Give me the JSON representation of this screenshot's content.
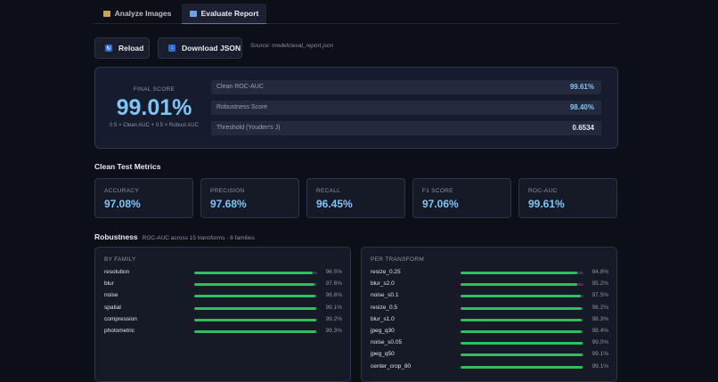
{
  "tabs": [
    {
      "label": "Analyze Images",
      "icon": "image-icon",
      "active": false
    },
    {
      "label": "Evaluate Report",
      "icon": "chart-icon",
      "active": true
    }
  ],
  "toolbar": {
    "reload_label": "Reload",
    "download_label": "Download JSON",
    "source_text": "Source: models\\eval_report.json"
  },
  "score": {
    "label": "FINAL SCORE",
    "value": "99.01%",
    "formula": "0.5 × Clean AUC + 0.5 × Robust AUC",
    "rows": [
      {
        "key": "Clean ROC-AUC",
        "value": "99.61%"
      },
      {
        "key": "Robustness Score",
        "value": "98.40%"
      },
      {
        "key": "Threshold (Youden's J)",
        "value": "0.6534"
      }
    ]
  },
  "clean": {
    "title": "Clean Test Metrics",
    "metrics": [
      {
        "label": "ACCURACY",
        "value": "97.08%"
      },
      {
        "label": "PRECISION",
        "value": "97.68%"
      },
      {
        "label": "RECALL",
        "value": "96.45%"
      },
      {
        "label": "F1 SCORE",
        "value": "97.06%"
      },
      {
        "label": "ROC-AUC",
        "value": "99.61%"
      }
    ]
  },
  "robustness": {
    "title": "Robustness",
    "subtitle": "ROC-AUC across 15 transforms · 6 families",
    "by_family": {
      "title": "BY FAMILY",
      "rows": [
        {
          "label": "resolution",
          "pct": "96.5%",
          "value": 96.5
        },
        {
          "label": "blur",
          "pct": "97.6%",
          "value": 97.6
        },
        {
          "label": "noise",
          "pct": "98.6%",
          "value": 98.6
        },
        {
          "label": "spatial",
          "pct": "99.1%",
          "value": 99.1
        },
        {
          "label": "compression",
          "pct": "99.2%",
          "value": 99.2
        },
        {
          "label": "photometric",
          "pct": "99.3%",
          "value": 99.3
        }
      ]
    },
    "per_transform": {
      "title": "PER TRANSFORM",
      "rows": [
        {
          "label": "resize_0.25",
          "pct": "94.8%",
          "value": 94.8
        },
        {
          "label": "blur_s2.0",
          "pct": "95.2%",
          "value": 95.2
        },
        {
          "label": "noise_s0.1",
          "pct": "97.5%",
          "value": 97.5
        },
        {
          "label": "resize_0.5",
          "pct": "98.2%",
          "value": 98.2
        },
        {
          "label": "blur_s1.0",
          "pct": "98.3%",
          "value": 98.3
        },
        {
          "label": "jpeg_q30",
          "pct": "98.4%",
          "value": 98.4
        },
        {
          "label": "noise_s0.05",
          "pct": "99.0%",
          "value": 99.0
        },
        {
          "label": "jpeg_q50",
          "pct": "99.1%",
          "value": 99.1
        },
        {
          "label": "center_crop_80",
          "pct": "99.1%",
          "value": 99.1
        }
      ]
    }
  },
  "colors": {
    "accent": "#7fc4f5",
    "bar_fill": "#2fbf5e",
    "active_tab_underline": "#4d7bd6",
    "button_icon": "#2f6fd0"
  }
}
